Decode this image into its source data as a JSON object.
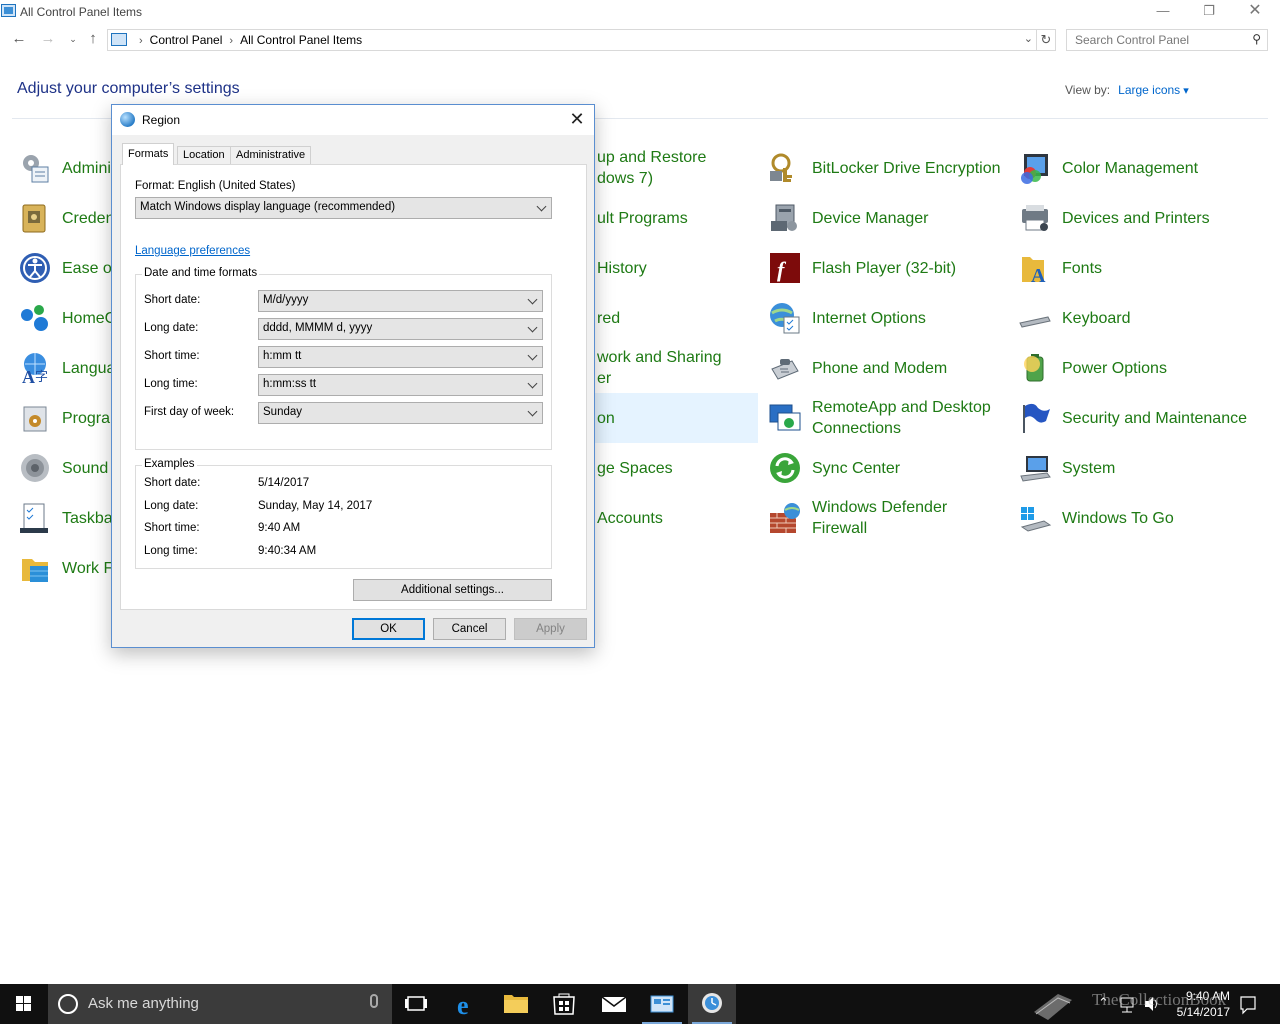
{
  "window": {
    "title": "All Control Panel Items",
    "controls": {
      "minimize": "—",
      "maximize": "❐",
      "close": "✕"
    }
  },
  "nav": {
    "breadcrumb": [
      "Control Panel",
      "All Control Panel Items"
    ],
    "search_placeholder": "Search Control Panel"
  },
  "page": {
    "heading": "Adjust your computer’s settings",
    "view_by_label": "View by:",
    "view_by_value": "Large icons"
  },
  "items": [
    {
      "label": "Admini",
      "icon": "administrative-tools-icon"
    },
    {
      "label": "Creden",
      "icon": "credential-manager-icon"
    },
    {
      "label": "Ease of",
      "icon": "ease-of-access-icon"
    },
    {
      "label": "HomeG",
      "icon": "homegroup-icon"
    },
    {
      "label": "Langua",
      "icon": "language-icon"
    },
    {
      "label": "Progra",
      "icon": "programs-icon"
    },
    {
      "label": "Sound",
      "icon": "sound-icon"
    },
    {
      "label": "Taskbar",
      "icon": "taskbar-icon"
    },
    {
      "label": "Work F",
      "icon": "work-folders-icon"
    },
    {
      "label": "up and Restore",
      "label2": "dows 7)",
      "icon": "backup-icon"
    },
    {
      "label": "ult Programs",
      "icon": "default-programs-icon"
    },
    {
      "label": "History",
      "icon": "file-history-icon"
    },
    {
      "label": "red",
      "icon": "indexing-icon"
    },
    {
      "label": "work and Sharing",
      "label2": "er",
      "icon": "network-icon"
    },
    {
      "label": "on",
      "icon": "region-icon"
    },
    {
      "label": "ge Spaces",
      "icon": "storage-spaces-icon"
    },
    {
      "label": "Accounts",
      "icon": "user-accounts-icon"
    },
    {
      "label": "BitLocker Drive Encryption",
      "icon": "bitlocker-icon"
    },
    {
      "label": "Device Manager",
      "icon": "device-manager-icon"
    },
    {
      "label": "Flash Player (32-bit)",
      "icon": "flash-player-icon"
    },
    {
      "label": "Internet Options",
      "icon": "internet-options-icon"
    },
    {
      "label": "Phone and Modem",
      "icon": "phone-modem-icon"
    },
    {
      "label": "RemoteApp and Desktop",
      "label2": "Connections",
      "icon": "remoteapp-icon"
    },
    {
      "label": "Sync Center",
      "icon": "sync-center-icon"
    },
    {
      "label": "Windows Defender",
      "label2": "Firewall",
      "icon": "firewall-icon"
    },
    {
      "label": "Color Management",
      "icon": "color-management-icon"
    },
    {
      "label": "Devices and Printers",
      "icon": "devices-printers-icon"
    },
    {
      "label": "Fonts",
      "icon": "fonts-icon"
    },
    {
      "label": "Keyboard",
      "icon": "keyboard-icon"
    },
    {
      "label": "Power Options",
      "icon": "power-options-icon"
    },
    {
      "label": "Security and Maintenance",
      "icon": "security-maintenance-icon"
    },
    {
      "label": "System",
      "icon": "system-icon"
    },
    {
      "label": "Windows To Go",
      "icon": "windows-to-go-icon"
    }
  ],
  "dialog": {
    "title": "Region",
    "close": "✕",
    "tabs": [
      "Formats",
      "Location",
      "Administrative"
    ],
    "format_label": "Format: English (United States)",
    "format_value": "Match Windows display language (recommended)",
    "language_link": "Language preferences",
    "dt_group_title": "Date and time formats",
    "formats": [
      {
        "label": "Short date:",
        "value": "M/d/yyyy"
      },
      {
        "label": "Long date:",
        "value": "dddd, MMMM d, yyyy"
      },
      {
        "label": "Short time:",
        "value": "h:mm tt"
      },
      {
        "label": "Long time:",
        "value": "h:mm:ss tt"
      },
      {
        "label": "First day of week:",
        "value": "Sunday"
      }
    ],
    "examples_title": "Examples",
    "examples": [
      {
        "label": "Short date:",
        "value": "5/14/2017"
      },
      {
        "label": "Long date:",
        "value": "Sunday, May 14, 2017"
      },
      {
        "label": "Short time:",
        "value": "9:40 AM"
      },
      {
        "label": "Long time:",
        "value": "9:40:34 AM"
      }
    ],
    "additional_settings": "Additional settings...",
    "ok": "OK",
    "cancel": "Cancel",
    "apply": "Apply"
  },
  "taskbar": {
    "search_placeholder": "Ask me anything",
    "time": "9:40 AM",
    "date": "5/14/2017"
  },
  "watermark": "TheCollectionBook"
}
